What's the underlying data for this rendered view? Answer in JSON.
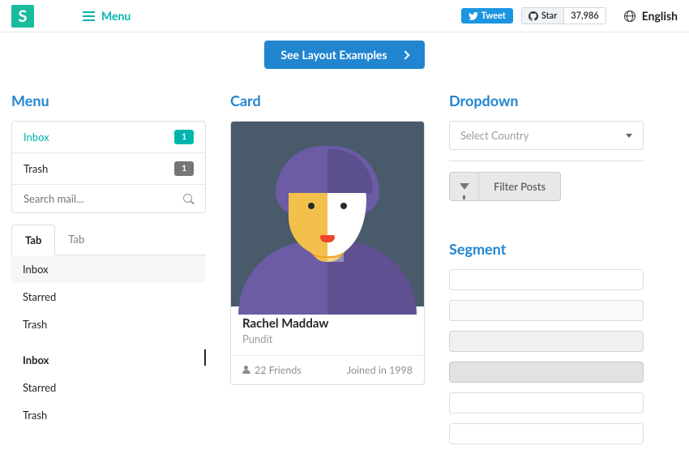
{
  "topbar": {
    "logo": "S",
    "menu_label": "Menu",
    "tweet_label": "Tweet",
    "star_label": "Star",
    "star_count": "37,986",
    "language": "English"
  },
  "hero": {
    "button_label": "See Layout Examples"
  },
  "menu_section": {
    "heading": "Menu",
    "items": [
      {
        "label": "Inbox",
        "badge": "1",
        "active": true
      },
      {
        "label": "Trash",
        "badge": "1",
        "active": false
      }
    ],
    "search_placeholder": "Search mail...",
    "tabs": [
      "Tab",
      "Tab"
    ],
    "list1": [
      "Inbox",
      "Starred",
      "Trash"
    ],
    "list2": [
      "Inbox",
      "Starred",
      "Trash"
    ]
  },
  "card_section": {
    "heading": "Card",
    "name": "Rachel Maddaw",
    "subtitle": "Pundit",
    "friends": "22 Friends",
    "joined": "Joined in 1998"
  },
  "dropdown_section": {
    "heading": "Dropdown",
    "select_placeholder": "Select Country",
    "filter_label": "Filter Posts"
  },
  "segment_section": {
    "heading": "Segment"
  }
}
